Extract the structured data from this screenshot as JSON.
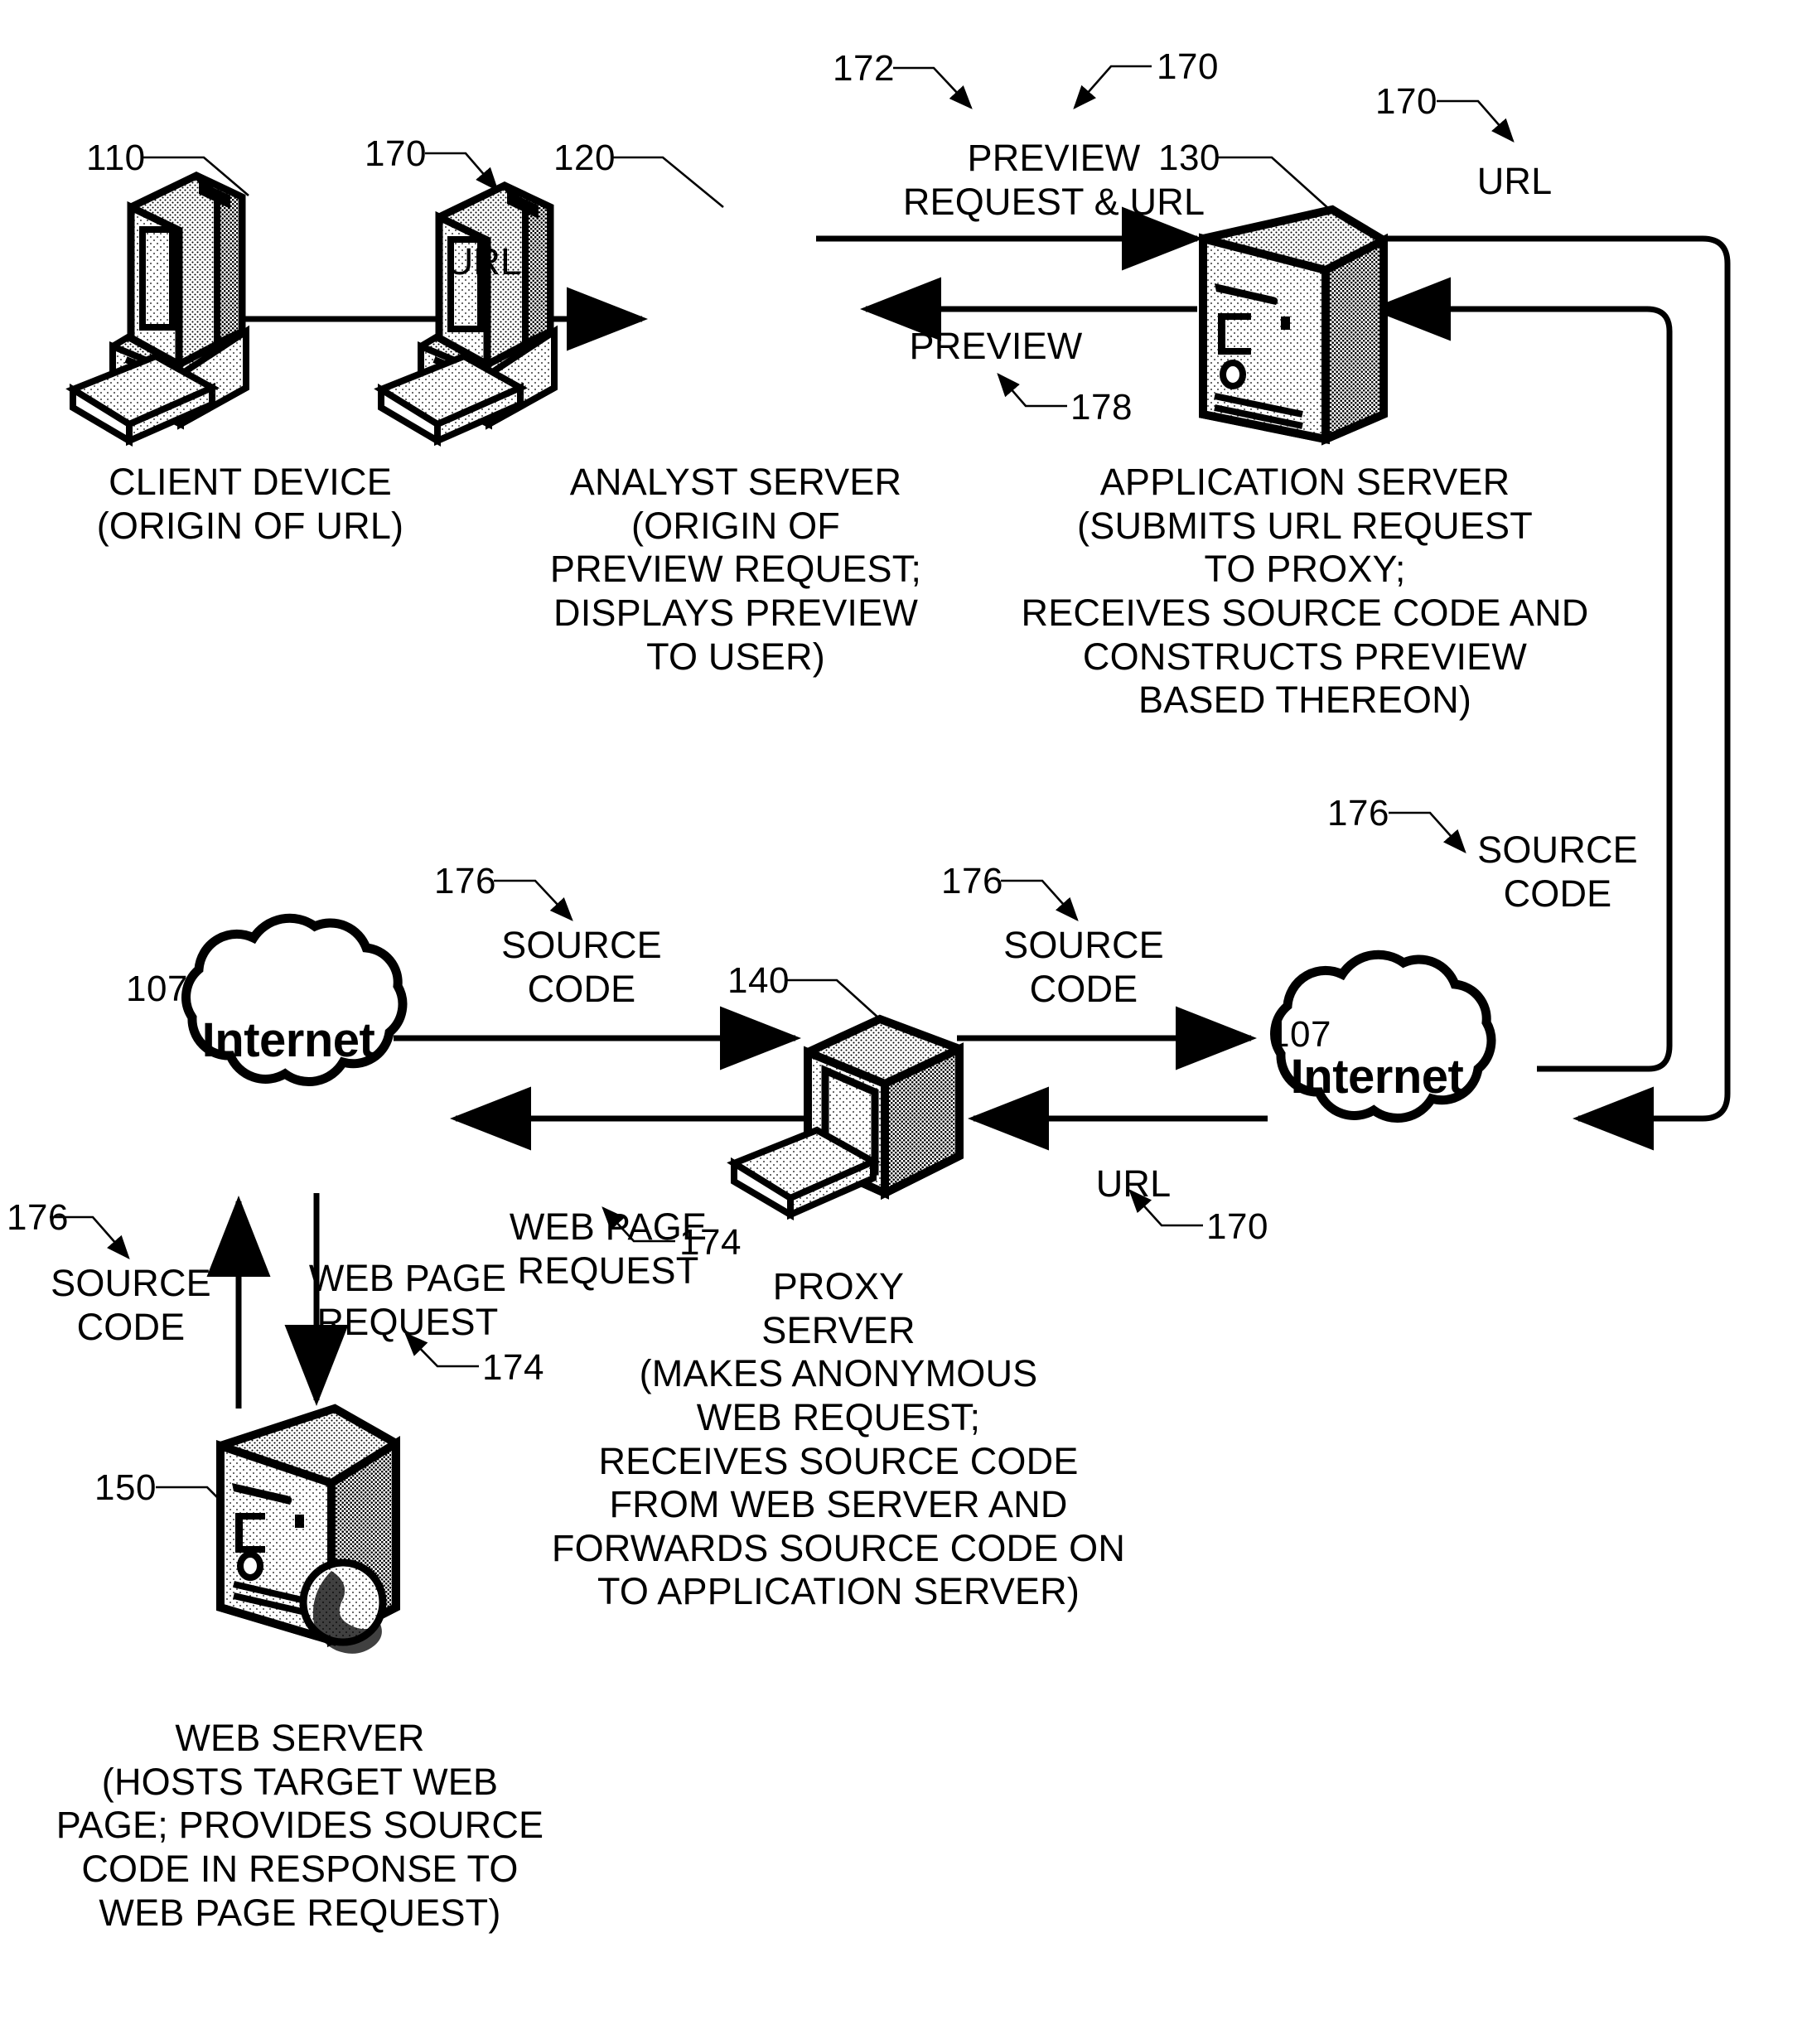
{
  "figure": {
    "type": "patent-network-diagram",
    "background": "#ffffff",
    "stroke": "#000000"
  },
  "reference_numerals": {
    "client_device": "110",
    "analyst_server": "120",
    "application_server": "130",
    "proxy_server": "140",
    "web_server": "150",
    "internet_left": "107",
    "internet_right": "107",
    "url_top_left": "170",
    "url_top_mid": "170",
    "url_top_right": "170",
    "url_bottom": "170",
    "preview_request_url": "172",
    "web_page_request_proxy": "174",
    "web_page_request_server": "174",
    "source_code_left": "176",
    "source_code_mid": "176",
    "source_code_right": "176",
    "source_code_far_right": "176",
    "source_code_bottom_left": "176",
    "preview": "178"
  },
  "flow_labels": {
    "url_client_to_analyst": "URL",
    "preview_request_and_url": "PREVIEW\nREQUEST & URL",
    "url_app_to_internet": "URL",
    "preview_app_to_analyst": "PREVIEW",
    "source_code_internet_right": "SOURCE\nCODE",
    "source_code_left_cloud_to_proxy": "SOURCE\nCODE",
    "source_code_proxy_to_right_cloud": "SOURCE\nCODE",
    "web_page_request_proxy_to_left_cloud": "WEB PAGE\nREQUEST",
    "url_right_cloud_to_proxy": "URL",
    "source_code_webserver_to_cloud": "SOURCE\nCODE",
    "web_page_request_cloud_to_webserver": "WEB PAGE\nREQUEST"
  },
  "nodes": {
    "client_device": {
      "icon": "desktop-computer-icon",
      "caption": "CLIENT DEVICE\n(ORIGIN OF URL)"
    },
    "analyst_server": {
      "icon": "desktop-computer-icon",
      "caption": "ANALYST SERVER\n(ORIGIN OF\nPREVIEW REQUEST;\nDISPLAYS PREVIEW\nTO USER)"
    },
    "application_server": {
      "icon": "tower-server-icon",
      "caption": "APPLICATION SERVER\n(SUBMITS URL REQUEST\nTO PROXY;\nRECEIVES SOURCE CODE AND\nCONSTRUCTS PREVIEW\nBASED THEREON)"
    },
    "proxy_server": {
      "icon": "crt-monitor-keyboard-icon",
      "caption": "PROXY\nSERVER\n(MAKES ANONYMOUS\nWEB REQUEST;\nRECEIVES SOURCE CODE\nFROM WEB SERVER AND\nFORWARDS SOURCE CODE ON\nTO APPLICATION SERVER)"
    },
    "web_server": {
      "icon": "tower-server-globe-icon",
      "caption": "WEB SERVER\n(HOSTS TARGET WEB\nPAGE; PROVIDES SOURCE\nCODE IN RESPONSE TO\nWEB PAGE REQUEST)"
    },
    "internet_left": {
      "icon": "cloud-icon",
      "label": "Internet"
    },
    "internet_right": {
      "icon": "cloud-icon",
      "label": "Internet"
    }
  }
}
